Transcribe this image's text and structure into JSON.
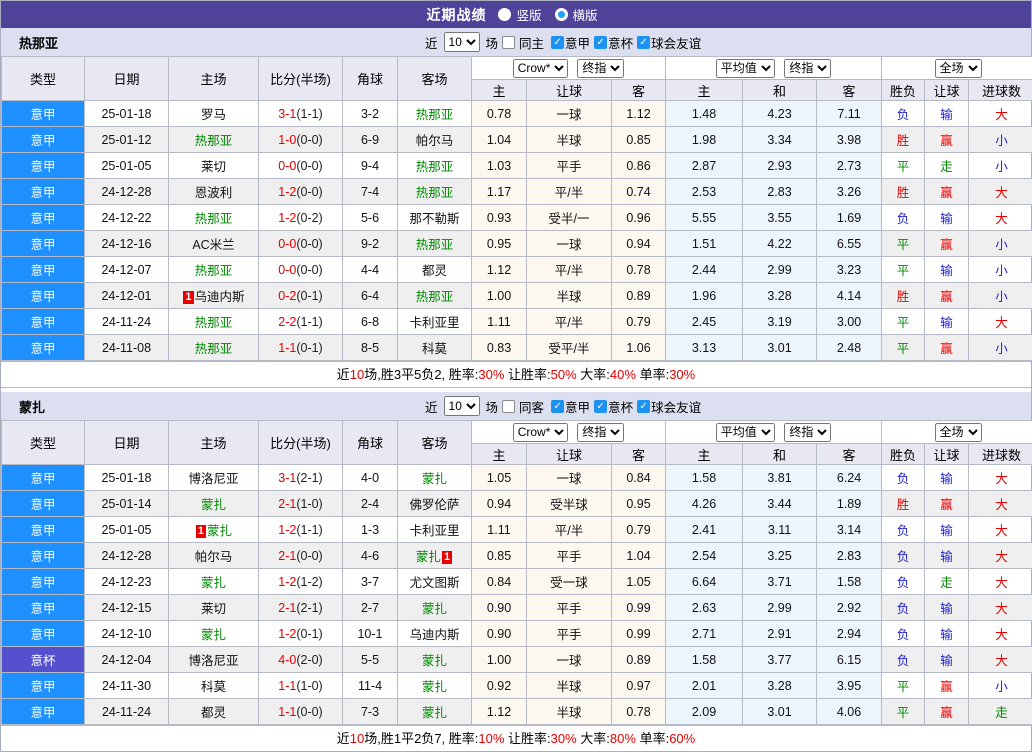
{
  "topbar": {
    "title": "近期战绩",
    "layout_options": [
      {
        "label": "竖版",
        "selected": false
      },
      {
        "label": "横版",
        "selected": true
      }
    ]
  },
  "filter_labels": {
    "near": "近",
    "games": "场"
  },
  "table_header": {
    "cols": [
      "类型",
      "日期",
      "主场",
      "比分(半场)",
      "角球",
      "客场"
    ],
    "sub": [
      "主",
      "让球",
      "客",
      "主",
      "和",
      "客",
      "胜负",
      "让球",
      "进球数"
    ],
    "selects": {
      "provider": "Crow*",
      "provider_final": "终指",
      "average": "平均值",
      "average_final": "终指",
      "scope": "全场"
    }
  },
  "colors": {
    "type_bg": {
      "意甲": "#1e90ff",
      "意杯": "#5550cd"
    },
    "result_map": {
      "胜": "#e60000",
      "赢": "#e60000",
      "大": "#e60000",
      "平": "#008800",
      "走": "#008800",
      "负": "#2222cc",
      "输": "#2222cc",
      "小": "#2222cc"
    },
    "self_team": "#008800",
    "score": "#e60000",
    "half_score": "#222222",
    "badge_bg": "#e60000",
    "summary_red": "#e60000"
  },
  "teams": [
    {
      "name": "热那亚",
      "filter": {
        "count": "10",
        "same_label": "同主",
        "same_checked": false,
        "leagues": [
          {
            "label": "意甲",
            "checked": true
          },
          {
            "label": "意杯",
            "checked": true
          },
          {
            "label": "球会友谊",
            "checked": true
          }
        ]
      },
      "rows": [
        {
          "type": "意甲",
          "date": "25-01-18",
          "home": {
            "name": "罗马"
          },
          "score": "3-1",
          "half": "(1-1)",
          "corners": "3-2",
          "away": {
            "name": "热那亚",
            "self": true
          },
          "odds": [
            "0.78",
            "一球",
            "1.12"
          ],
          "avg": [
            "1.48",
            "4.23",
            "7.11"
          ],
          "result": [
            "负",
            "输",
            "大"
          ]
        },
        {
          "type": "意甲",
          "date": "25-01-12",
          "home": {
            "name": "热那亚",
            "self": true
          },
          "score": "1-0",
          "half": "(0-0)",
          "corners": "6-9",
          "away": {
            "name": "帕尔马"
          },
          "odds": [
            "1.04",
            "半球",
            "0.85"
          ],
          "avg": [
            "1.98",
            "3.34",
            "3.98"
          ],
          "result": [
            "胜",
            "赢",
            "小"
          ]
        },
        {
          "type": "意甲",
          "date": "25-01-05",
          "home": {
            "name": "莱切"
          },
          "score": "0-0",
          "half": "(0-0)",
          "corners": "9-4",
          "away": {
            "name": "热那亚",
            "self": true
          },
          "odds": [
            "1.03",
            "平手",
            "0.86"
          ],
          "avg": [
            "2.87",
            "2.93",
            "2.73"
          ],
          "result": [
            "平",
            "走",
            "小"
          ]
        },
        {
          "type": "意甲",
          "date": "24-12-28",
          "home": {
            "name": "恩波利"
          },
          "score": "1-2",
          "half": "(0-0)",
          "corners": "7-4",
          "away": {
            "name": "热那亚",
            "self": true
          },
          "odds": [
            "1.17",
            "平/半",
            "0.74"
          ],
          "avg": [
            "2.53",
            "2.83",
            "3.26"
          ],
          "result": [
            "胜",
            "赢",
            "大"
          ]
        },
        {
          "type": "意甲",
          "date": "24-12-22",
          "home": {
            "name": "热那亚",
            "self": true
          },
          "score": "1-2",
          "half": "(0-2)",
          "corners": "5-6",
          "away": {
            "name": "那不勒斯"
          },
          "odds": [
            "0.93",
            "受半/一",
            "0.96"
          ],
          "avg": [
            "5.55",
            "3.55",
            "1.69"
          ],
          "result": [
            "负",
            "输",
            "大"
          ]
        },
        {
          "type": "意甲",
          "date": "24-12-16",
          "home": {
            "name": "AC米兰"
          },
          "score": "0-0",
          "half": "(0-0)",
          "corners": "9-2",
          "away": {
            "name": "热那亚",
            "self": true
          },
          "odds": [
            "0.95",
            "一球",
            "0.94"
          ],
          "avg": [
            "1.51",
            "4.22",
            "6.55"
          ],
          "result": [
            "平",
            "赢",
            "小"
          ]
        },
        {
          "type": "意甲",
          "date": "24-12-07",
          "home": {
            "name": "热那亚",
            "self": true
          },
          "score": "0-0",
          "half": "(0-0)",
          "corners": "4-4",
          "away": {
            "name": "都灵"
          },
          "odds": [
            "1.12",
            "平/半",
            "0.78"
          ],
          "avg": [
            "2.44",
            "2.99",
            "3.23"
          ],
          "result": [
            "平",
            "输",
            "小"
          ]
        },
        {
          "type": "意甲",
          "date": "24-12-01",
          "home": {
            "name": "乌迪内斯",
            "badge_pre": "1"
          },
          "score": "0-2",
          "half": "(0-1)",
          "corners": "6-4",
          "away": {
            "name": "热那亚",
            "self": true
          },
          "odds": [
            "1.00",
            "半球",
            "0.89"
          ],
          "avg": [
            "1.96",
            "3.28",
            "4.14"
          ],
          "result": [
            "胜",
            "赢",
            "小"
          ]
        },
        {
          "type": "意甲",
          "date": "24-11-24",
          "home": {
            "name": "热那亚",
            "self": true
          },
          "score": "2-2",
          "half": "(1-1)",
          "corners": "6-8",
          "away": {
            "name": "卡利亚里"
          },
          "odds": [
            "1.11",
            "平/半",
            "0.79"
          ],
          "avg": [
            "2.45",
            "3.19",
            "3.00"
          ],
          "result": [
            "平",
            "输",
            "大"
          ]
        },
        {
          "type": "意甲",
          "date": "24-11-08",
          "home": {
            "name": "热那亚",
            "self": true
          },
          "score": "1-1",
          "half": "(0-1)",
          "corners": "8-5",
          "away": {
            "name": "科莫"
          },
          "odds": [
            "0.83",
            "受平/半",
            "1.06"
          ],
          "avg": [
            "3.13",
            "3.01",
            "2.48"
          ],
          "result": [
            "平",
            "赢",
            "小"
          ]
        }
      ],
      "summary": [
        {
          "text": "近"
        },
        {
          "text": "10",
          "red": true
        },
        {
          "text": "场,胜3平5负2, 胜率:"
        },
        {
          "text": "30%",
          "red": true
        },
        {
          "text": " 让胜率:"
        },
        {
          "text": "50%",
          "red": true
        },
        {
          "text": " 大率:"
        },
        {
          "text": "40%",
          "red": true
        },
        {
          "text": " 单率:"
        },
        {
          "text": "30%",
          "red": true
        }
      ]
    },
    {
      "name": "蒙扎",
      "filter": {
        "count": "10",
        "same_label": "同客",
        "same_checked": false,
        "leagues": [
          {
            "label": "意甲",
            "checked": true
          },
          {
            "label": "意杯",
            "checked": true
          },
          {
            "label": "球会友谊",
            "checked": true
          }
        ]
      },
      "rows": [
        {
          "type": "意甲",
          "date": "25-01-18",
          "home": {
            "name": "博洛尼亚"
          },
          "score": "3-1",
          "half": "(2-1)",
          "corners": "4-0",
          "away": {
            "name": "蒙扎",
            "self": true
          },
          "odds": [
            "1.05",
            "一球",
            "0.84"
          ],
          "avg": [
            "1.58",
            "3.81",
            "6.24"
          ],
          "result": [
            "负",
            "输",
            "大"
          ]
        },
        {
          "type": "意甲",
          "date": "25-01-14",
          "home": {
            "name": "蒙扎",
            "self": true
          },
          "score": "2-1",
          "half": "(1-0)",
          "corners": "2-4",
          "away": {
            "name": "佛罗伦萨"
          },
          "odds": [
            "0.94",
            "受半球",
            "0.95"
          ],
          "avg": [
            "4.26",
            "3.44",
            "1.89"
          ],
          "result": [
            "胜",
            "赢",
            "大"
          ]
        },
        {
          "type": "意甲",
          "date": "25-01-05",
          "home": {
            "name": "蒙扎",
            "self": true,
            "badge_pre": "1"
          },
          "score": "1-2",
          "half": "(1-1)",
          "corners": "1-3",
          "away": {
            "name": "卡利亚里"
          },
          "odds": [
            "1.11",
            "平/半",
            "0.79"
          ],
          "avg": [
            "2.41",
            "3.11",
            "3.14"
          ],
          "result": [
            "负",
            "输",
            "大"
          ]
        },
        {
          "type": "意甲",
          "date": "24-12-28",
          "home": {
            "name": "帕尔马"
          },
          "score": "2-1",
          "half": "(0-0)",
          "corners": "4-6",
          "away": {
            "name": "蒙扎",
            "self": true,
            "badge_post": "1"
          },
          "odds": [
            "0.85",
            "平手",
            "1.04"
          ],
          "avg": [
            "2.54",
            "3.25",
            "2.83"
          ],
          "result": [
            "负",
            "输",
            "大"
          ]
        },
        {
          "type": "意甲",
          "date": "24-12-23",
          "home": {
            "name": "蒙扎",
            "self": true
          },
          "score": "1-2",
          "half": "(1-2)",
          "corners": "3-7",
          "away": {
            "name": "尤文图斯"
          },
          "odds": [
            "0.84",
            "受一球",
            "1.05"
          ],
          "avg": [
            "6.64",
            "3.71",
            "1.58"
          ],
          "result": [
            "负",
            "走",
            "大"
          ]
        },
        {
          "type": "意甲",
          "date": "24-12-15",
          "home": {
            "name": "莱切"
          },
          "score": "2-1",
          "half": "(2-1)",
          "corners": "2-7",
          "away": {
            "name": "蒙扎",
            "self": true
          },
          "odds": [
            "0.90",
            "平手",
            "0.99"
          ],
          "avg": [
            "2.63",
            "2.99",
            "2.92"
          ],
          "result": [
            "负",
            "输",
            "大"
          ]
        },
        {
          "type": "意甲",
          "date": "24-12-10",
          "home": {
            "name": "蒙扎",
            "self": true
          },
          "score": "1-2",
          "half": "(0-1)",
          "corners": "10-1",
          "away": {
            "name": "乌迪内斯"
          },
          "odds": [
            "0.90",
            "平手",
            "0.99"
          ],
          "avg": [
            "2.71",
            "2.91",
            "2.94"
          ],
          "result": [
            "负",
            "输",
            "大"
          ]
        },
        {
          "type": "意杯",
          "date": "24-12-04",
          "home": {
            "name": "博洛尼亚"
          },
          "score": "4-0",
          "half": "(2-0)",
          "corners": "5-5",
          "away": {
            "name": "蒙扎",
            "self": true
          },
          "odds": [
            "1.00",
            "一球",
            "0.89"
          ],
          "avg": [
            "1.58",
            "3.77",
            "6.15"
          ],
          "result": [
            "负",
            "输",
            "大"
          ]
        },
        {
          "type": "意甲",
          "date": "24-11-30",
          "home": {
            "name": "科莫"
          },
          "score": "1-1",
          "half": "(1-0)",
          "corners": "11-4",
          "away": {
            "name": "蒙扎",
            "self": true
          },
          "odds": [
            "0.92",
            "半球",
            "0.97"
          ],
          "avg": [
            "2.01",
            "3.28",
            "3.95"
          ],
          "result": [
            "平",
            "赢",
            "小"
          ]
        },
        {
          "type": "意甲",
          "date": "24-11-24",
          "home": {
            "name": "都灵"
          },
          "score": "1-1",
          "half": "(0-0)",
          "corners": "7-3",
          "away": {
            "name": "蒙扎",
            "self": true
          },
          "odds": [
            "1.12",
            "半球",
            "0.78"
          ],
          "avg": [
            "2.09",
            "3.01",
            "4.06"
          ],
          "result": [
            "平",
            "赢",
            "走"
          ]
        }
      ],
      "summary": [
        {
          "text": "近"
        },
        {
          "text": "10",
          "red": true
        },
        {
          "text": "场,胜1平2负7, 胜率:"
        },
        {
          "text": "10%",
          "red": true
        },
        {
          "text": " 让胜率:"
        },
        {
          "text": "30%",
          "red": true
        },
        {
          "text": " 大率:"
        },
        {
          "text": "80%",
          "red": true
        },
        {
          "text": " 单率:"
        },
        {
          "text": "60%",
          "red": true
        }
      ]
    }
  ]
}
